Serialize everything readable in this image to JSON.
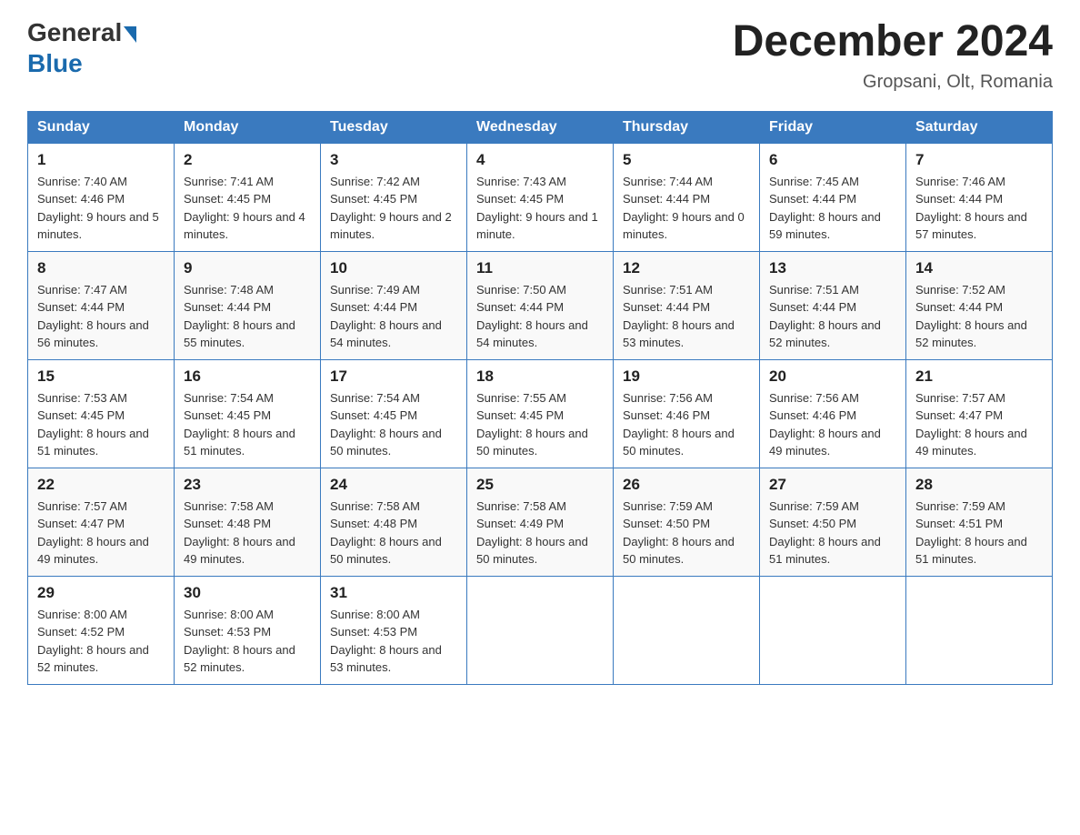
{
  "header": {
    "logo_general": "General",
    "logo_blue": "Blue",
    "month_title": "December 2024",
    "location": "Gropsani, Olt, Romania"
  },
  "weekdays": [
    "Sunday",
    "Monday",
    "Tuesday",
    "Wednesday",
    "Thursday",
    "Friday",
    "Saturday"
  ],
  "weeks": [
    [
      {
        "day": "1",
        "sunrise": "7:40 AM",
        "sunset": "4:46 PM",
        "daylight": "9 hours and 5 minutes."
      },
      {
        "day": "2",
        "sunrise": "7:41 AM",
        "sunset": "4:45 PM",
        "daylight": "9 hours and 4 minutes."
      },
      {
        "day": "3",
        "sunrise": "7:42 AM",
        "sunset": "4:45 PM",
        "daylight": "9 hours and 2 minutes."
      },
      {
        "day": "4",
        "sunrise": "7:43 AM",
        "sunset": "4:45 PM",
        "daylight": "9 hours and 1 minute."
      },
      {
        "day": "5",
        "sunrise": "7:44 AM",
        "sunset": "4:44 PM",
        "daylight": "9 hours and 0 minutes."
      },
      {
        "day": "6",
        "sunrise": "7:45 AM",
        "sunset": "4:44 PM",
        "daylight": "8 hours and 59 minutes."
      },
      {
        "day": "7",
        "sunrise": "7:46 AM",
        "sunset": "4:44 PM",
        "daylight": "8 hours and 57 minutes."
      }
    ],
    [
      {
        "day": "8",
        "sunrise": "7:47 AM",
        "sunset": "4:44 PM",
        "daylight": "8 hours and 56 minutes."
      },
      {
        "day": "9",
        "sunrise": "7:48 AM",
        "sunset": "4:44 PM",
        "daylight": "8 hours and 55 minutes."
      },
      {
        "day": "10",
        "sunrise": "7:49 AM",
        "sunset": "4:44 PM",
        "daylight": "8 hours and 54 minutes."
      },
      {
        "day": "11",
        "sunrise": "7:50 AM",
        "sunset": "4:44 PM",
        "daylight": "8 hours and 54 minutes."
      },
      {
        "day": "12",
        "sunrise": "7:51 AM",
        "sunset": "4:44 PM",
        "daylight": "8 hours and 53 minutes."
      },
      {
        "day": "13",
        "sunrise": "7:51 AM",
        "sunset": "4:44 PM",
        "daylight": "8 hours and 52 minutes."
      },
      {
        "day": "14",
        "sunrise": "7:52 AM",
        "sunset": "4:44 PM",
        "daylight": "8 hours and 52 minutes."
      }
    ],
    [
      {
        "day": "15",
        "sunrise": "7:53 AM",
        "sunset": "4:45 PM",
        "daylight": "8 hours and 51 minutes."
      },
      {
        "day": "16",
        "sunrise": "7:54 AM",
        "sunset": "4:45 PM",
        "daylight": "8 hours and 51 minutes."
      },
      {
        "day": "17",
        "sunrise": "7:54 AM",
        "sunset": "4:45 PM",
        "daylight": "8 hours and 50 minutes."
      },
      {
        "day": "18",
        "sunrise": "7:55 AM",
        "sunset": "4:45 PM",
        "daylight": "8 hours and 50 minutes."
      },
      {
        "day": "19",
        "sunrise": "7:56 AM",
        "sunset": "4:46 PM",
        "daylight": "8 hours and 50 minutes."
      },
      {
        "day": "20",
        "sunrise": "7:56 AM",
        "sunset": "4:46 PM",
        "daylight": "8 hours and 49 minutes."
      },
      {
        "day": "21",
        "sunrise": "7:57 AM",
        "sunset": "4:47 PM",
        "daylight": "8 hours and 49 minutes."
      }
    ],
    [
      {
        "day": "22",
        "sunrise": "7:57 AM",
        "sunset": "4:47 PM",
        "daylight": "8 hours and 49 minutes."
      },
      {
        "day": "23",
        "sunrise": "7:58 AM",
        "sunset": "4:48 PM",
        "daylight": "8 hours and 49 minutes."
      },
      {
        "day": "24",
        "sunrise": "7:58 AM",
        "sunset": "4:48 PM",
        "daylight": "8 hours and 50 minutes."
      },
      {
        "day": "25",
        "sunrise": "7:58 AM",
        "sunset": "4:49 PM",
        "daylight": "8 hours and 50 minutes."
      },
      {
        "day": "26",
        "sunrise": "7:59 AM",
        "sunset": "4:50 PM",
        "daylight": "8 hours and 50 minutes."
      },
      {
        "day": "27",
        "sunrise": "7:59 AM",
        "sunset": "4:50 PM",
        "daylight": "8 hours and 51 minutes."
      },
      {
        "day": "28",
        "sunrise": "7:59 AM",
        "sunset": "4:51 PM",
        "daylight": "8 hours and 51 minutes."
      }
    ],
    [
      {
        "day": "29",
        "sunrise": "8:00 AM",
        "sunset": "4:52 PM",
        "daylight": "8 hours and 52 minutes."
      },
      {
        "day": "30",
        "sunrise": "8:00 AM",
        "sunset": "4:53 PM",
        "daylight": "8 hours and 52 minutes."
      },
      {
        "day": "31",
        "sunrise": "8:00 AM",
        "sunset": "4:53 PM",
        "daylight": "8 hours and 53 minutes."
      },
      null,
      null,
      null,
      null
    ]
  ],
  "labels": {
    "sunrise_prefix": "Sunrise: ",
    "sunset_prefix": "Sunset: ",
    "daylight_prefix": "Daylight: "
  }
}
